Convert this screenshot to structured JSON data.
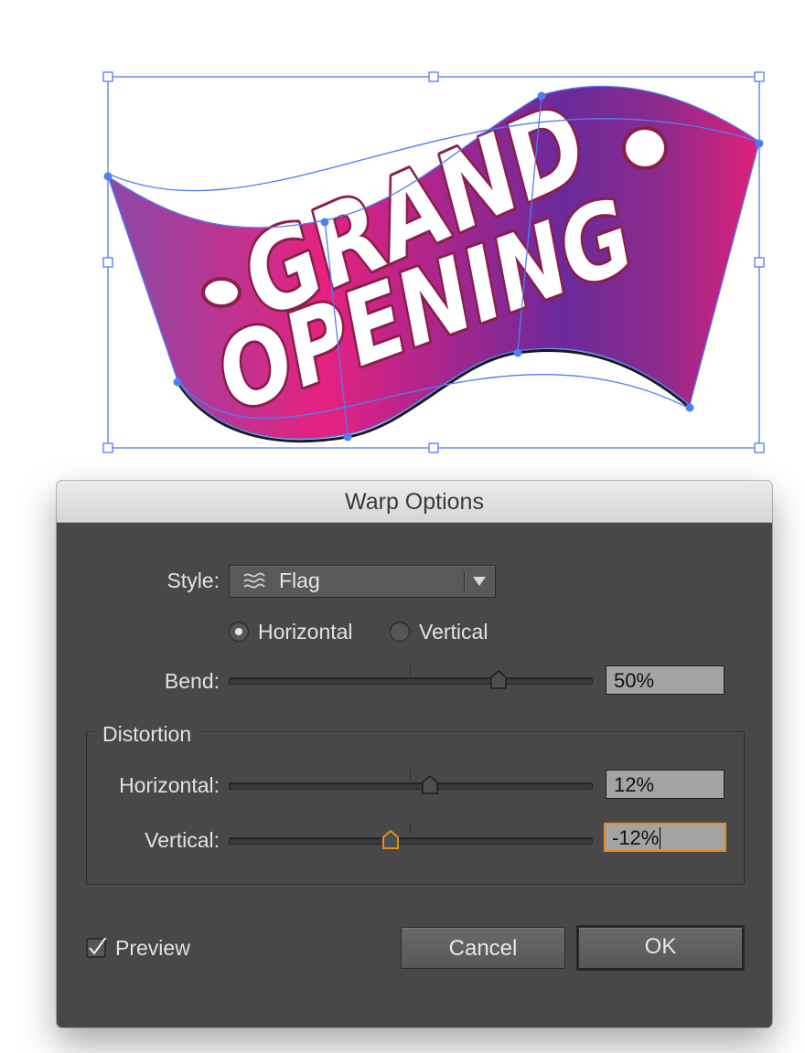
{
  "artwork": {
    "line1": "GRAND",
    "line2": "OPENING",
    "gradient_colors": [
      "#8a4aa6",
      "#e52280",
      "#6a2a9a",
      "#8e2a8c",
      "#e02078"
    ],
    "outline_color": "#8a1f4a",
    "selection_color": "#4f7df5"
  },
  "dialog": {
    "title": "Warp Options",
    "style_label": "Style:",
    "style_value": "Flag",
    "style_icon": "flag-warp-icon",
    "orientation": {
      "horizontal": "Horizontal",
      "vertical": "Vertical",
      "selected": "Horizontal"
    },
    "bend_label": "Bend:",
    "bend_value": "50%",
    "bend_level": 50,
    "distortion_title": "Distortion",
    "horizontal_label": "Horizontal:",
    "horizontal_value": "12%",
    "horizontal_level": 12,
    "vertical_label": "Vertical:",
    "vertical_value": "-12%",
    "vertical_level": -12,
    "preview_label": "Preview",
    "preview_checked": true,
    "cancel_label": "Cancel",
    "ok_label": "OK",
    "focus_color": "#e8891f"
  }
}
